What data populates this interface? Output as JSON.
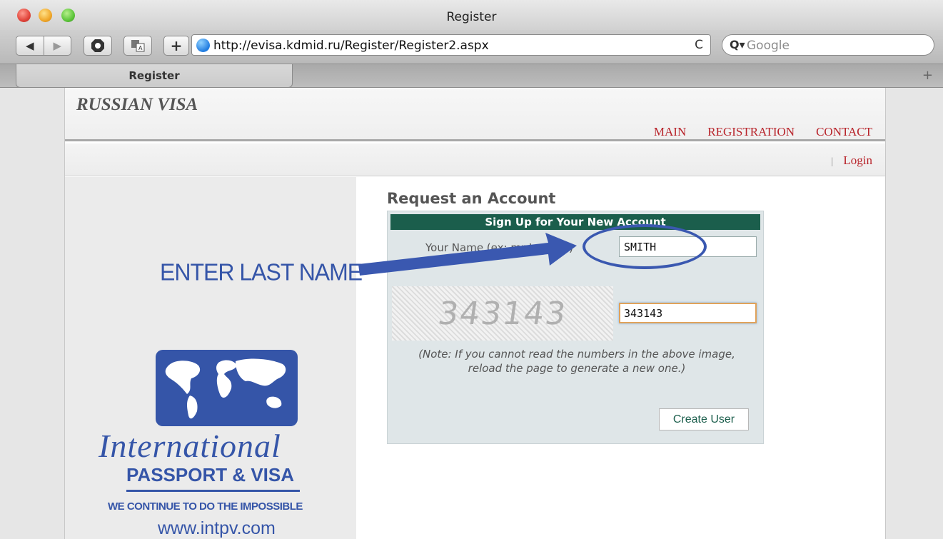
{
  "window": {
    "title": "Register"
  },
  "toolbar": {
    "back_label": "◀",
    "forward_label": "▶",
    "add_label": "+",
    "url": "http://evisa.kdmid.ru/Register/Register2.aspx",
    "reload_label": "C",
    "search_placeholder": "Google"
  },
  "tabs": [
    {
      "label": "Register",
      "active": true
    }
  ],
  "site": {
    "brand": "RUSSIAN VISA",
    "nav": [
      "MAIN",
      "REGISTRATION",
      "CONTACT"
    ],
    "login_label": "Login"
  },
  "logo": {
    "name": "International",
    "subtitle": "PASSPORT & VISA",
    "tagline": "WE CONTINUE TO DO THE IMPOSSIBLE",
    "url": "www.intpv.com"
  },
  "form": {
    "title": "Request an Account",
    "header": "Sign Up for Your New Account",
    "name_label": "Your Name (ex: mr Ivanoff )",
    "name_value": "SMITH",
    "captcha_text": "343143",
    "captcha_value": "343143",
    "note": "(Note: If you cannot read the numbers in the above image, reload the page to generate a new one.)",
    "submit_label": "Create User"
  },
  "annotation": {
    "text": "ENTER LAST NAME"
  },
  "colors": {
    "accent_red": "#b8232a",
    "form_header": "#1b5e4c",
    "annotation_blue": "#3555a8"
  }
}
